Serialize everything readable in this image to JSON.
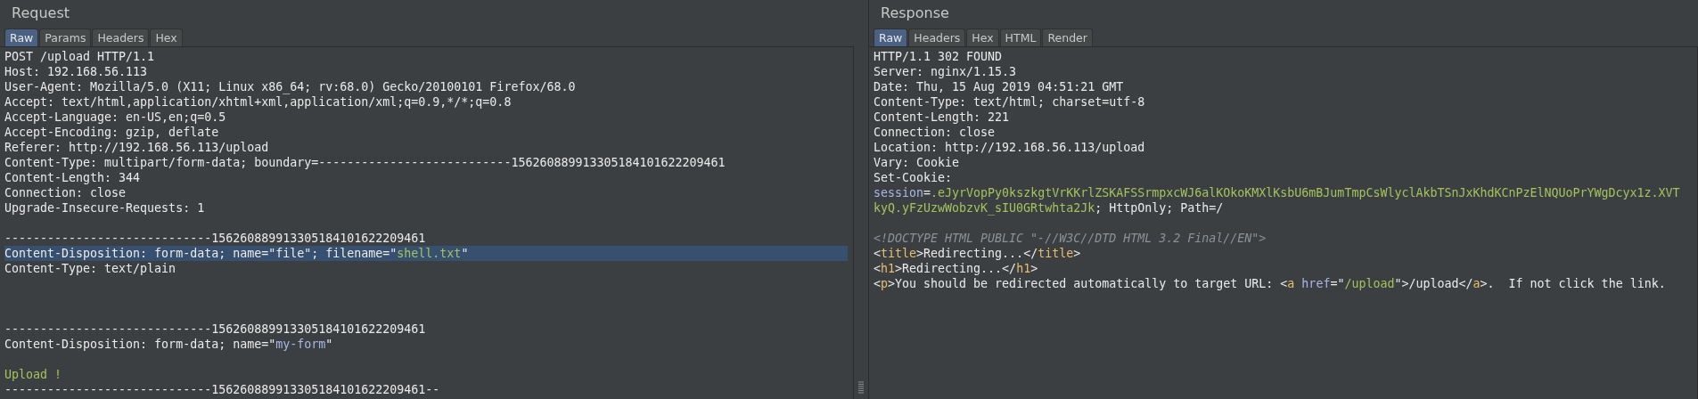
{
  "request": {
    "title": "Request",
    "tabs": [
      {
        "label": "Raw",
        "selected": true
      },
      {
        "label": "Params",
        "selected": false
      },
      {
        "label": "Headers",
        "selected": false
      },
      {
        "label": "Hex",
        "selected": false
      }
    ],
    "lines": [
      {
        "kind": "code",
        "selected": false,
        "segments": [
          {
            "kind": "plain",
            "text": "POST /upload HTTP/1.1"
          }
        ]
      },
      {
        "kind": "code",
        "selected": false,
        "segments": [
          {
            "kind": "plain",
            "text": "Host: 192.168.56.113"
          }
        ]
      },
      {
        "kind": "code",
        "selected": false,
        "segments": [
          {
            "kind": "plain",
            "text": "User-Agent: Mozilla/5.0 (X11; Linux x86_64; rv:68.0) Gecko/20100101 Firefox/68.0"
          }
        ]
      },
      {
        "kind": "code",
        "selected": false,
        "segments": [
          {
            "kind": "plain",
            "text": "Accept: text/html,application/xhtml+xml,application/xml;q=0.9,*/*;q=0.8"
          }
        ]
      },
      {
        "kind": "code",
        "selected": false,
        "segments": [
          {
            "kind": "plain",
            "text": "Accept-Language: en-US,en;q=0.5"
          }
        ]
      },
      {
        "kind": "code",
        "selected": false,
        "segments": [
          {
            "kind": "plain",
            "text": "Accept-Encoding: gzip, deflate"
          }
        ]
      },
      {
        "kind": "code",
        "selected": false,
        "segments": [
          {
            "kind": "plain",
            "text": "Referer: http://192.168.56.113/upload"
          }
        ]
      },
      {
        "kind": "code",
        "selected": false,
        "segments": [
          {
            "kind": "plain",
            "text": "Content-Type: multipart/form-data; boundary=---------------------------156260889913305184101622209461"
          }
        ]
      },
      {
        "kind": "code",
        "selected": false,
        "segments": [
          {
            "kind": "plain",
            "text": "Content-Length: 344"
          }
        ]
      },
      {
        "kind": "code",
        "selected": false,
        "segments": [
          {
            "kind": "plain",
            "text": "Connection: close"
          }
        ]
      },
      {
        "kind": "code",
        "selected": false,
        "segments": [
          {
            "kind": "plain",
            "text": "Upgrade-Insecure-Requests: 1"
          }
        ]
      },
      {
        "kind": "blank"
      },
      {
        "kind": "code",
        "selected": false,
        "segments": [
          {
            "kind": "plain",
            "text": "-----------------------------156260889913305184101622209461"
          }
        ]
      },
      {
        "kind": "code",
        "selected": true,
        "segments": [
          {
            "kind": "plain",
            "text": "Content-Disposition: form-data; name=\"file\"; filename=\""
          },
          {
            "kind": "string",
            "text": "shell.txt"
          },
          {
            "kind": "plain",
            "text": "\""
          }
        ]
      },
      {
        "kind": "code",
        "selected": false,
        "segments": [
          {
            "kind": "plain",
            "text": "Content-Type: text/plain"
          }
        ]
      },
      {
        "kind": "blank"
      },
      {
        "kind": "blank"
      },
      {
        "kind": "blank"
      },
      {
        "kind": "code",
        "selected": false,
        "segments": [
          {
            "kind": "plain",
            "text": "-----------------------------156260889913305184101622209461"
          }
        ]
      },
      {
        "kind": "code",
        "selected": false,
        "segments": [
          {
            "kind": "plain",
            "text": "Content-Disposition: form-data; name=\""
          },
          {
            "kind": "attr",
            "text": "my-form"
          },
          {
            "kind": "plain",
            "text": "\""
          }
        ]
      },
      {
        "kind": "blank"
      },
      {
        "kind": "code",
        "selected": false,
        "segments": [
          {
            "kind": "string",
            "text": "Upload !"
          }
        ]
      },
      {
        "kind": "code",
        "selected": false,
        "segments": [
          {
            "kind": "plain",
            "text": "-----------------------------156260889913305184101622209461--"
          }
        ]
      }
    ]
  },
  "response": {
    "title": "Response",
    "tabs": [
      {
        "label": "Raw",
        "selected": true
      },
      {
        "label": "Headers",
        "selected": false
      },
      {
        "label": "Hex",
        "selected": false
      },
      {
        "label": "HTML",
        "selected": false
      },
      {
        "label": "Render",
        "selected": false
      }
    ],
    "lines": [
      {
        "kind": "code",
        "selected": false,
        "segments": [
          {
            "kind": "plain",
            "text": "HTTP/1.1 302 FOUND"
          }
        ]
      },
      {
        "kind": "code",
        "selected": false,
        "segments": [
          {
            "kind": "plain",
            "text": "Server: nginx/1.15.3"
          }
        ]
      },
      {
        "kind": "code",
        "selected": false,
        "segments": [
          {
            "kind": "plain",
            "text": "Date: Thu, 15 Aug 2019 04:51:21 GMT"
          }
        ]
      },
      {
        "kind": "code",
        "selected": false,
        "segments": [
          {
            "kind": "plain",
            "text": "Content-Type: text/html; charset=utf-8"
          }
        ]
      },
      {
        "kind": "code",
        "selected": false,
        "segments": [
          {
            "kind": "plain",
            "text": "Content-Length: 221"
          }
        ]
      },
      {
        "kind": "code",
        "selected": false,
        "segments": [
          {
            "kind": "plain",
            "text": "Connection: close"
          }
        ]
      },
      {
        "kind": "code",
        "selected": false,
        "segments": [
          {
            "kind": "plain",
            "text": "Location: http://192.168.56.113/upload"
          }
        ]
      },
      {
        "kind": "code",
        "selected": false,
        "segments": [
          {
            "kind": "plain",
            "text": "Vary: Cookie"
          }
        ]
      },
      {
        "kind": "code",
        "selected": false,
        "segments": [
          {
            "kind": "plain",
            "text": "Set-Cookie:"
          }
        ]
      },
      {
        "kind": "code",
        "selected": false,
        "segments": [
          {
            "kind": "attr",
            "text": "session"
          },
          {
            "kind": "plain",
            "text": "="
          },
          {
            "kind": "string",
            "text": ".eJyrVopPy0kszkgtVrKKrlZSKAFSSrmpxcWJ6alKOkoKMXlKsbU6mBJumTmpCsWlyclAkbTSnJxKhdKCnPzElNQUoPrYWgDcyx1z.XVT"
          }
        ]
      },
      {
        "kind": "code",
        "selected": false,
        "segments": [
          {
            "kind": "string",
            "text": "kyQ.yFzUzwWobzvK_sIU0GRtwhta2Jk"
          },
          {
            "kind": "plain",
            "text": "; HttpOnly; Path=/"
          }
        ]
      },
      {
        "kind": "blank"
      },
      {
        "kind": "code",
        "selected": false,
        "segments": [
          {
            "kind": "comment",
            "text": "<!DOCTYPE HTML PUBLIC \"-//W3C//DTD HTML 3.2 Final//EN\">"
          }
        ]
      },
      {
        "kind": "code",
        "selected": false,
        "segments": [
          {
            "kind": "plain",
            "text": "<"
          },
          {
            "kind": "tag",
            "text": "title"
          },
          {
            "kind": "plain",
            "text": ">Redirecting...</"
          },
          {
            "kind": "tag",
            "text": "title"
          },
          {
            "kind": "plain",
            "text": ">"
          }
        ]
      },
      {
        "kind": "code",
        "selected": false,
        "segments": [
          {
            "kind": "plain",
            "text": "<"
          },
          {
            "kind": "tag",
            "text": "h1"
          },
          {
            "kind": "plain",
            "text": ">Redirecting...</"
          },
          {
            "kind": "tag",
            "text": "h1"
          },
          {
            "kind": "plain",
            "text": ">"
          }
        ]
      },
      {
        "kind": "code",
        "selected": false,
        "segments": [
          {
            "kind": "plain",
            "text": "<"
          },
          {
            "kind": "tag",
            "text": "p"
          },
          {
            "kind": "plain",
            "text": ">You should be redirected automatically to target URL: <"
          },
          {
            "kind": "tag",
            "text": "a"
          },
          {
            "kind": "attr",
            "text": " href"
          },
          {
            "kind": "plain",
            "text": "=\""
          },
          {
            "kind": "string",
            "text": "/upload"
          },
          {
            "kind": "plain",
            "text": "\">/upload</"
          },
          {
            "kind": "tag",
            "text": "a"
          },
          {
            "kind": "plain",
            "text": ">.  If not click the link."
          }
        ]
      }
    ]
  }
}
